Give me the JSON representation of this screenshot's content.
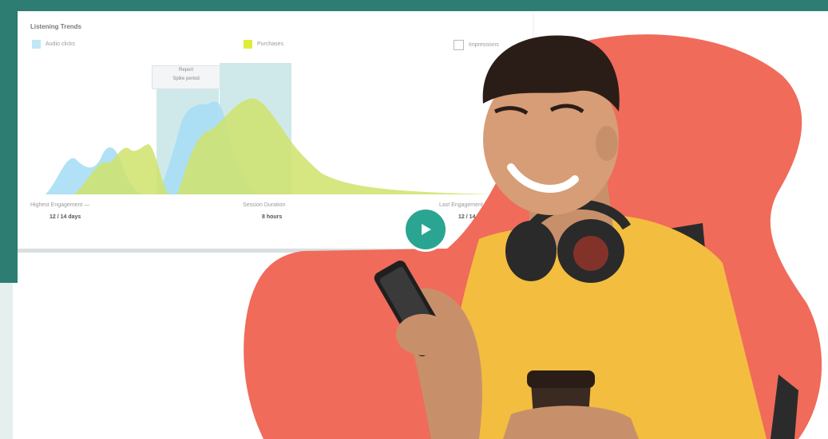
{
  "dashboard": {
    "title": "Listening Trends",
    "legend": [
      {
        "label": "Audio clicks",
        "color": "#bfe7f7"
      },
      {
        "label": "Purchases",
        "color": "#e0ec3c"
      },
      {
        "label": "Impressions",
        "color": "#ffffff"
      }
    ],
    "tooltip": {
      "line1": "Report",
      "line2": "Spike period"
    },
    "metrics": [
      {
        "label": "Highest Engagement  —",
        "value": "12 / 14 days"
      },
      {
        "label": "Session Duration",
        "value": "8 hours"
      },
      {
        "label": "Last Engagement",
        "value": "12 / 14 days"
      }
    ]
  },
  "colors": {
    "teal": "#2e7d72",
    "play": "#2aa592",
    "coral": "#f06b5a",
    "shirt": "#f3bd3f",
    "series_blue": "#8fd6f3",
    "series_green": "#c6e36a"
  },
  "video": {
    "play_icon": "play-icon"
  }
}
